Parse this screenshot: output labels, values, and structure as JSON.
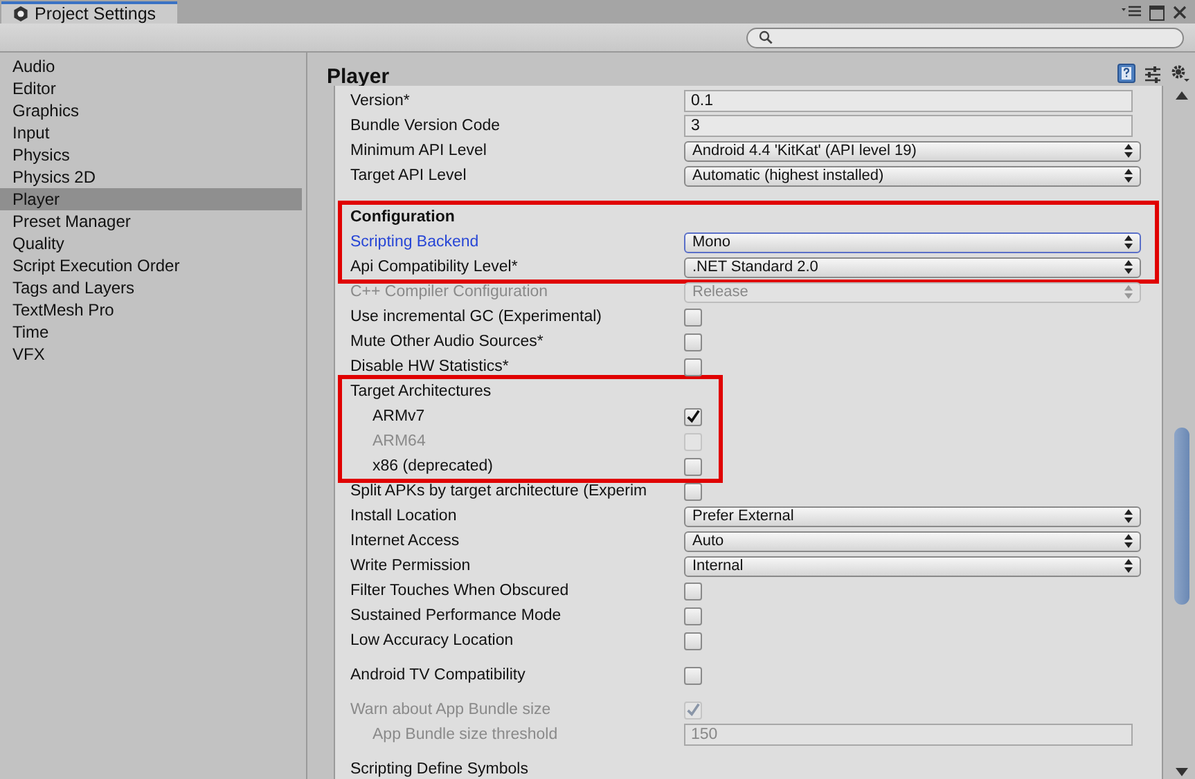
{
  "window": {
    "title": "Project Settings"
  },
  "sidebar": {
    "items": [
      {
        "label": "Audio",
        "selected": false
      },
      {
        "label": "Editor",
        "selected": false
      },
      {
        "label": "Graphics",
        "selected": false
      },
      {
        "label": "Input",
        "selected": false
      },
      {
        "label": "Physics",
        "selected": false
      },
      {
        "label": "Physics 2D",
        "selected": false
      },
      {
        "label": "Player",
        "selected": true
      },
      {
        "label": "Preset Manager",
        "selected": false
      },
      {
        "label": "Quality",
        "selected": false
      },
      {
        "label": "Script Execution Order",
        "selected": false
      },
      {
        "label": "Tags and Layers",
        "selected": false
      },
      {
        "label": "TextMesh Pro",
        "selected": false
      },
      {
        "label": "Time",
        "selected": false
      },
      {
        "label": "VFX",
        "selected": false
      }
    ]
  },
  "panel": {
    "title": "Player"
  },
  "sections": [
    {
      "kind": "plain",
      "rows": [
        {
          "kind": "text",
          "label": "Version*",
          "value": "0.1",
          "disabled": false
        },
        {
          "kind": "text",
          "label": "Bundle Version Code",
          "value": "3",
          "disabled": false
        },
        {
          "kind": "dropdown",
          "label": "Minimum API Level",
          "value": "Android 4.4 'KitKat' (API level 19)",
          "disabled": false
        },
        {
          "kind": "dropdown",
          "label": "Target API Level",
          "value": "Automatic (highest installed)",
          "disabled": false
        }
      ]
    },
    {
      "kind": "highlight-wide",
      "rows": [
        {
          "kind": "header",
          "label": "Configuration"
        },
        {
          "kind": "dropdown",
          "label": "Scripting Backend",
          "value": "Mono",
          "disabled": false,
          "focused": true
        },
        {
          "kind": "dropdown",
          "label": "Api Compatibility Level*",
          "value": ".NET Standard 2.0",
          "disabled": false
        }
      ]
    },
    {
      "kind": "continued",
      "rows": [
        {
          "kind": "dropdown",
          "label": "C++ Compiler Configuration",
          "value": "Release",
          "disabled": true
        },
        {
          "kind": "checkbox",
          "label": "Use incremental GC (Experimental)",
          "checked": false,
          "disabled": false
        },
        {
          "kind": "checkbox",
          "label": "Mute Other Audio Sources*",
          "checked": false,
          "disabled": false
        },
        {
          "kind": "checkbox",
          "label": "Disable HW Statistics*",
          "checked": false,
          "disabled": false
        }
      ]
    },
    {
      "kind": "highlight-narrow",
      "rows": [
        {
          "kind": "label",
          "label": "Target Architectures",
          "children": [
            {
              "kind": "checkbox",
              "label": "ARMv7",
              "checked": true,
              "disabled": false
            },
            {
              "kind": "checkbox",
              "label": "ARM64",
              "checked": false,
              "disabled": true
            },
            {
              "kind": "checkbox",
              "label": "x86 (deprecated)",
              "checked": false,
              "disabled": false
            }
          ]
        }
      ]
    },
    {
      "kind": "continued",
      "rows": [
        {
          "kind": "checkbox",
          "label": "Split APKs by target architecture (Experim",
          "checked": false,
          "disabled": false
        },
        {
          "kind": "dropdown",
          "label": "Install Location",
          "value": "Prefer External",
          "disabled": false
        },
        {
          "kind": "dropdown",
          "label": "Internet Access",
          "value": "Auto",
          "disabled": false
        },
        {
          "kind": "dropdown",
          "label": "Write Permission",
          "value": "Internal",
          "disabled": false
        },
        {
          "kind": "checkbox",
          "label": "Filter Touches When Obscured",
          "checked": false,
          "disabled": false
        },
        {
          "kind": "checkbox",
          "label": "Sustained Performance Mode",
          "checked": false,
          "disabled": false
        },
        {
          "kind": "checkbox",
          "label": "Low Accuracy Location",
          "checked": false,
          "disabled": false
        }
      ]
    },
    {
      "kind": "plain",
      "rows": [
        {
          "kind": "checkbox",
          "label": "Android TV Compatibility",
          "checked": false,
          "disabled": false
        }
      ]
    },
    {
      "kind": "plain",
      "rows": [
        {
          "kind": "checkbox",
          "label": "Warn about App Bundle size",
          "checked": true,
          "disabled": true,
          "children": [
            {
              "kind": "text",
              "label": "App Bundle size threshold",
              "value": "150",
              "disabled": true
            }
          ]
        }
      ]
    },
    {
      "kind": "plain",
      "rows": [
        {
          "kind": "label",
          "label": "Scripting Define Symbols"
        }
      ]
    }
  ]
}
